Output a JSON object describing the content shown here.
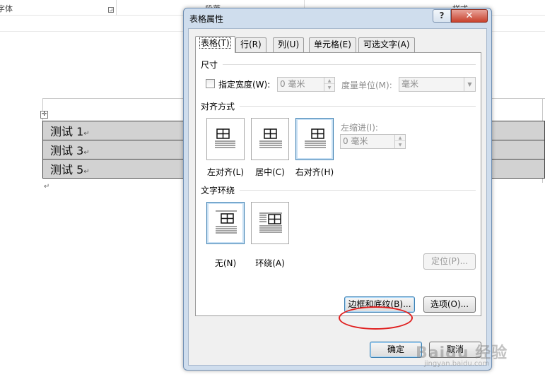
{
  "background": {
    "ribbon": {
      "font_group_label": "字体",
      "para_group_label": "段落",
      "style_group_label": "样式"
    },
    "table_rows": [
      "测试 1",
      "测试 3",
      "测试 5"
    ],
    "return_mark": "↵",
    "move_handle_glyph": "✛"
  },
  "dialog": {
    "title": "表格属性",
    "help_label": "?",
    "close_label": "✕",
    "tabs": [
      {
        "label": "表格(T)",
        "active": true
      },
      {
        "label": "行(R)",
        "active": false
      },
      {
        "label": "列(U)",
        "active": false
      },
      {
        "label": "单元格(E)",
        "active": false
      },
      {
        "label": "可选文字(A)",
        "active": false
      }
    ],
    "size": {
      "title": "尺寸",
      "preferred_width_label": "指定宽度(W):",
      "width_value": "0 毫米",
      "unit_label": "度量单位(M):",
      "unit_value": "毫米"
    },
    "alignment": {
      "title": "对齐方式",
      "options": [
        {
          "label": "左对齐(L)",
          "selected": false
        },
        {
          "label": "居中(C)",
          "selected": false
        },
        {
          "label": "右对齐(H)",
          "selected": true
        }
      ],
      "indent_label": "左缩进(I):",
      "indent_value": "0 毫米"
    },
    "wrapping": {
      "title": "文字环绕",
      "options": [
        {
          "label": "无(N)",
          "selected": true
        },
        {
          "label": "环绕(A)",
          "selected": false
        }
      ],
      "positioning_label": "定位(P)..."
    },
    "borders_shading_label": "边框和底纹(B)...",
    "options_label": "选项(O)...",
    "ok_label": "确定",
    "cancel_label": "取消"
  },
  "watermark": {
    "text": "Baidu 经验",
    "subtext": "jingyan.baidu.com"
  },
  "colors": {
    "selected_border": "#3c7fb1",
    "close_red": "#c8412c",
    "highlight_ring": "#e02020",
    "table_fill": "#d2d2d2"
  }
}
